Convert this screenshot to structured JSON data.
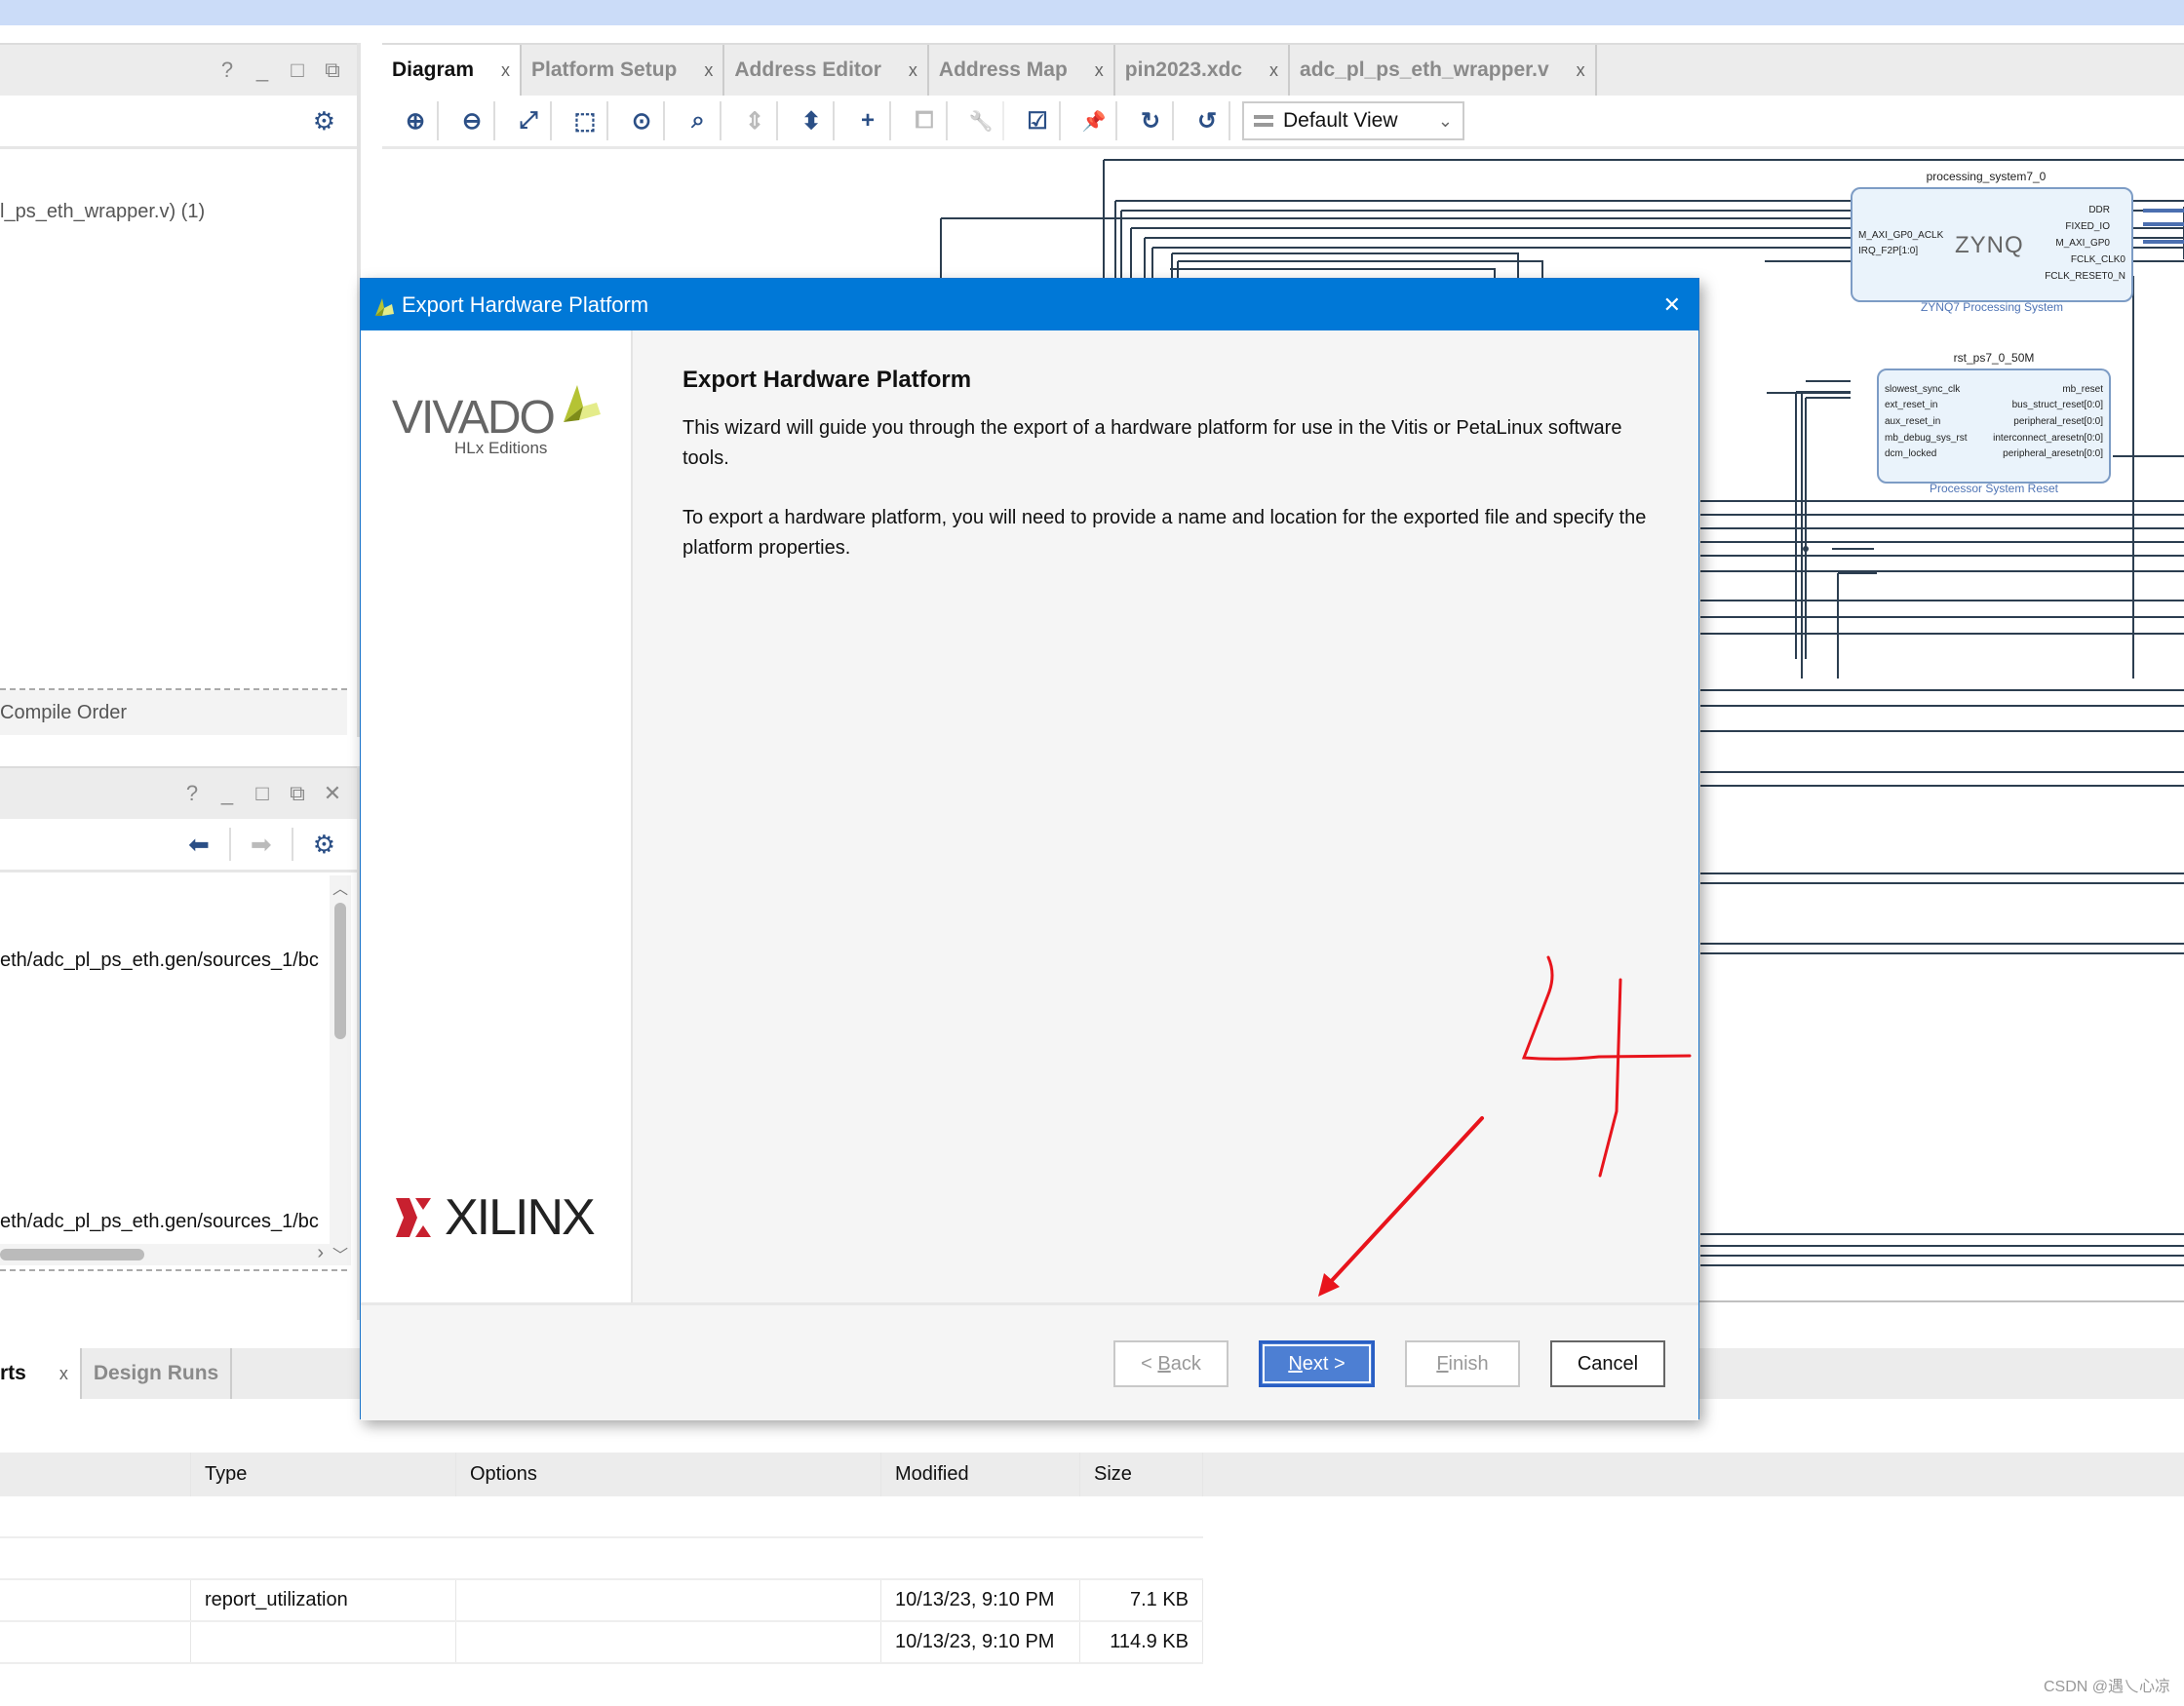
{
  "left_panel_top": {
    "controls": [
      "?",
      "_",
      "□",
      "⧉"
    ],
    "tree_item": "l_ps_eth_wrapper.v) (1)",
    "footer_tab": "Compile Order"
  },
  "left_panel_bottom": {
    "controls": [
      "?",
      "_",
      "□",
      "⧉",
      "✕"
    ],
    "rows": [
      "eth/adc_pl_ps_eth.gen/sources_1/bc",
      "eth/adc_pl_ps_eth.gen/sources_1/bc"
    ]
  },
  "editor": {
    "tabs": [
      {
        "label": "Diagram",
        "active": true
      },
      {
        "label": "Platform Setup",
        "active": false
      },
      {
        "label": "Address Editor",
        "active": false
      },
      {
        "label": "Address Map",
        "active": false
      },
      {
        "label": "pin2023.xdc",
        "active": false
      },
      {
        "label": "adc_pl_ps_eth_wrapper.v",
        "active": false
      }
    ],
    "tab_close": "x",
    "toolbar": [
      {
        "icon": "zoom-in-icon",
        "glyph": "⊕"
      },
      {
        "icon": "zoom-out-icon",
        "glyph": "⊖"
      },
      {
        "icon": "zoom-fit-icon",
        "glyph": "⤢"
      },
      {
        "icon": "zoom-selection-icon",
        "glyph": "⬚"
      },
      {
        "icon": "center-icon",
        "glyph": "⊙"
      },
      {
        "icon": "search-icon",
        "glyph": "⌕"
      },
      {
        "icon": "collapse-icon",
        "glyph": "⇕",
        "disabled": true
      },
      {
        "icon": "expand-icon",
        "glyph": "⬍"
      },
      {
        "icon": "add-ip-icon",
        "glyph": "+"
      },
      {
        "icon": "make-external-icon",
        "glyph": "⧠",
        "disabled": true
      },
      {
        "icon": "properties-wrench-icon",
        "glyph": "🔧",
        "disabled": true
      },
      {
        "icon": "validate-design-icon",
        "glyph": "☑"
      },
      {
        "icon": "pin-icon",
        "glyph": "📌"
      },
      {
        "icon": "refresh-icon",
        "glyph": "↻"
      },
      {
        "icon": "regenerate-layout-icon",
        "glyph": "↺"
      }
    ],
    "view_select": "Default View"
  },
  "diagram": {
    "ps7": {
      "name": "processing_system7_0",
      "logo": "ZYNQ",
      "subtitle": "ZYNQ7 Processing System",
      "in_ports": [
        "M_AXI_GP0_ACLK",
        "IRQ_F2P[1:0]"
      ],
      "out_ports": [
        "DDR",
        "FIXED_IO",
        "M_AXI_GP0",
        "FCLK_CLK0",
        "FCLK_RESET0_N"
      ]
    },
    "rst": {
      "name": "rst_ps7_0_50M",
      "subtitle": "Processor System Reset",
      "in_ports": [
        "slowest_sync_clk",
        "ext_reset_in",
        "aux_reset_in",
        "mb_debug_sys_rst",
        "dcm_locked"
      ],
      "out_ports": [
        "mb_reset",
        "bus_struct_reset[0:0]",
        "peripheral_reset[0:0]",
        "interconnect_aresetn[0:0]",
        "peripheral_aresetn[0:0]"
      ]
    }
  },
  "dialog": {
    "title": "Export Hardware Platform",
    "close": "✕",
    "logo_top": "VIVADO",
    "logo_sub": "HLx Editions",
    "logo_bottom": "XILINX",
    "heading": "Export Hardware Platform",
    "paragraphs": [
      "This wizard will guide you through the export of a hardware platform for use in the Vitis or PetaLinux software tools.",
      "To export a hardware platform, you will need to provide a name and location for the exported file and specify the platform properties."
    ],
    "buttons": {
      "back": {
        "prefix": "< ",
        "mnemonic": "B",
        "rest": "ack",
        "enabled": false
      },
      "next": {
        "prefix": "",
        "mnemonic": "N",
        "rest": "ext >",
        "enabled": true
      },
      "finish": {
        "prefix": "",
        "mnemonic": "F",
        "rest": "inish",
        "enabled": false
      },
      "cancel": {
        "label": "Cancel",
        "enabled": true
      }
    }
  },
  "annotation": {
    "step_number": "4",
    "color": "#e8141c"
  },
  "bottom_panel": {
    "tabs": [
      {
        "label": "rts",
        "active": true
      },
      {
        "label": "Design Runs",
        "active": false
      }
    ],
    "tab_close": "x",
    "table": {
      "columns": [
        "",
        "Type",
        "Options",
        "Modified",
        "Size"
      ],
      "rows": [
        [
          "",
          "",
          "",
          "",
          ""
        ],
        [
          "",
          "",
          "",
          "",
          ""
        ],
        [
          "",
          "report_utilization",
          "",
          "10/13/23, 9:10 PM",
          "7.1 KB"
        ],
        [
          "",
          "",
          "",
          "10/13/23, 9:10 PM",
          "114.9 KB"
        ]
      ]
    }
  },
  "watermark": "CSDN @遇乀心凉",
  "colors": {
    "dialog_title_bar": "#0078d7",
    "primary_button": "#4d7fd3",
    "icon_blue": "#2b4f86",
    "ip_block_fill": "#eaf3fb"
  }
}
